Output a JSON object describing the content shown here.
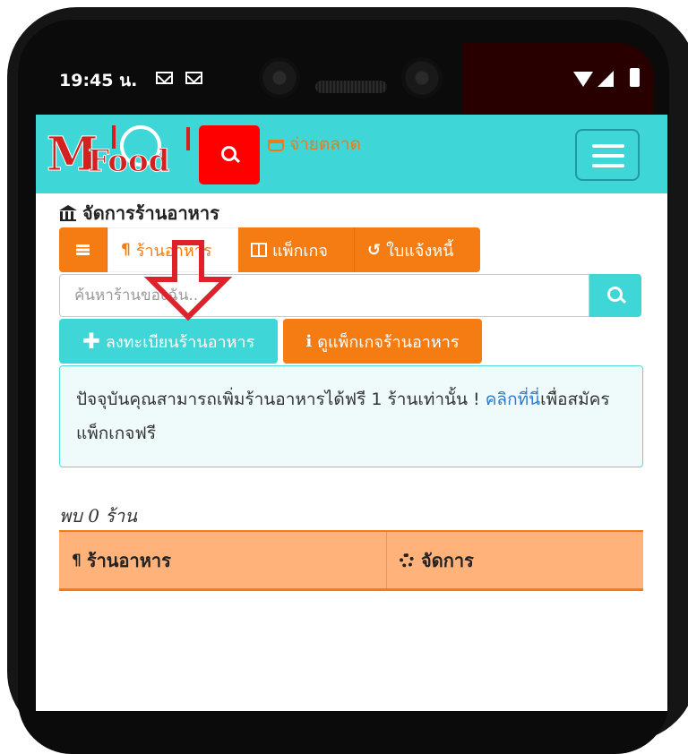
{
  "status_bar": {
    "time": "19:45 น."
  },
  "navbar": {
    "logo_m": "M",
    "logo_food": "Food",
    "market_label": "จ่ายตลาด"
  },
  "page": {
    "title": "จัดการร้านอาหาร"
  },
  "tabs": [
    {
      "label": "ร้านอาหาร",
      "icon": "fork-knife-icon",
      "active": true
    },
    {
      "label": "แพ็กเกจ",
      "icon": "columns-icon",
      "active": false
    },
    {
      "label": "ใบแจ้งหนี้",
      "icon": "history-icon",
      "active": false
    }
  ],
  "search": {
    "placeholder": "ค้นหาร้านของฉัน.."
  },
  "buttons": {
    "register": "ลงทะเบียนร้านอาหาร",
    "packages": "ดูแพ็กเกจร้านอาหาร"
  },
  "alert": {
    "text_before": "ปัจจุบันคุณสามารถเพิ่มร้านอาหารได้ฟรี 1 ร้านเท่านั้น ! ",
    "link": "คลิกที่นี่",
    "text_after": "เพื่อสมัครแพ็กเกจฟรี"
  },
  "results": {
    "found": "พบ 0 ร้าน"
  },
  "table": {
    "headers": [
      "ร้านอาหาร",
      "จัดการ"
    ]
  },
  "colors": {
    "accent_teal": "#3ed6d6",
    "accent_orange": "#f47c12",
    "search_red": "#ff0000",
    "arrow_red": "#e0202a"
  }
}
